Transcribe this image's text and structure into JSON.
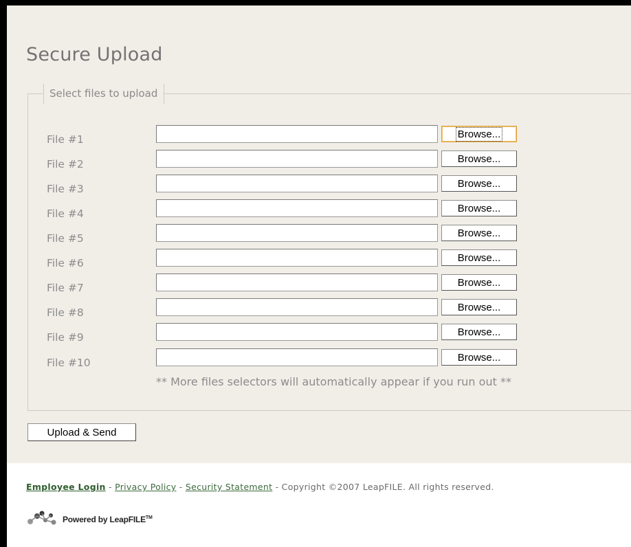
{
  "page": {
    "title": "Secure Upload",
    "legend": "Select files to upload"
  },
  "files": [
    {
      "label": "File #1",
      "value": "",
      "browse_label": "Browse..."
    },
    {
      "label": "File #2",
      "value": "",
      "browse_label": "Browse..."
    },
    {
      "label": "File #3",
      "value": "",
      "browse_label": "Browse..."
    },
    {
      "label": "File #4",
      "value": "",
      "browse_label": "Browse..."
    },
    {
      "label": "File #5",
      "value": "",
      "browse_label": "Browse..."
    },
    {
      "label": "File #6",
      "value": "",
      "browse_label": "Browse..."
    },
    {
      "label": "File #7",
      "value": "",
      "browse_label": "Browse..."
    },
    {
      "label": "File #8",
      "value": "",
      "browse_label": "Browse..."
    },
    {
      "label": "File #9",
      "value": "",
      "browse_label": "Browse..."
    },
    {
      "label": "File #10",
      "value": "",
      "browse_label": "Browse..."
    }
  ],
  "note": "** More files selectors will automatically appear if you run out **",
  "upload_button": "Upload & Send",
  "footer": {
    "employee_login": "Employee Login",
    "sep1": " - ",
    "privacy_policy": "Privacy Policy",
    "sep2": " - ",
    "security_statement": "Security Statement",
    "copyright": " - Copyright ©2007 LeapFILE. All rights reserved."
  },
  "powered_by": {
    "text": "Powered by LeapFILE",
    "trademark": "TM",
    "logo_icon": "leapfile-logo-icon"
  },
  "colors": {
    "panel_background": "#f1eee8",
    "link_green": "#3d6a3d",
    "label_gray": "#8c8c8c"
  }
}
